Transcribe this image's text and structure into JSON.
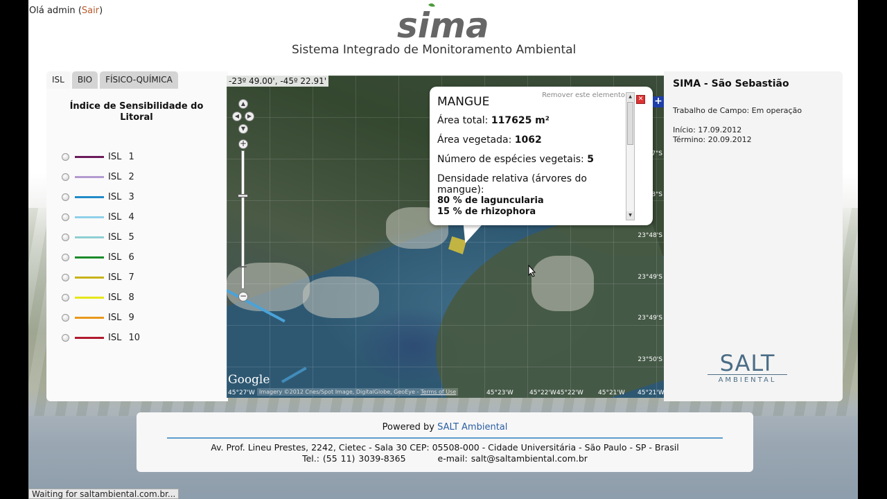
{
  "header": {
    "greeting": "Olá admin",
    "open_paren": "(",
    "logout": "Sair",
    "close_paren": ")",
    "logo": "sima",
    "subtitle": "Sistema Integrado de Monitoramento Ambiental"
  },
  "tabs": [
    {
      "label": "ISL",
      "active": true
    },
    {
      "label": "BIO",
      "active": false
    },
    {
      "label": "FÍSICO-QUÍMICA",
      "active": false
    }
  ],
  "legend": {
    "title": "Índice de Sensibilidade do Litoral",
    "items": [
      {
        "label": "ISL 1",
        "color": "#6b1a5a"
      },
      {
        "label": "ISL 2",
        "color": "#b39ad0"
      },
      {
        "label": "ISL 3",
        "color": "#1f8bc8"
      },
      {
        "label": "ISL 4",
        "color": "#8fd0ea"
      },
      {
        "label": "ISL 5",
        "color": "#8ecfd3"
      },
      {
        "label": "ISL 6",
        "color": "#1a8a2a"
      },
      {
        "label": "ISL 7",
        "color": "#c9b21a"
      },
      {
        "label": "ISL 8",
        "color": "#e6e61a"
      },
      {
        "label": "ISL 9",
        "color": "#e8981c"
      },
      {
        "label": "ISL 10",
        "color": "#b01a2e"
      }
    ]
  },
  "map": {
    "coords": "-23º 49.00', -45º 22.91'",
    "lat_labels": [
      "7\"S",
      "8\"S",
      "23°48'S",
      "23°49'S",
      "23°49'S",
      "23°50'S"
    ],
    "lon_labels": [
      "45°27'W",
      "45°23'W",
      "45°22'W",
      "45°22'W",
      "45°21'W",
      "45°21'W"
    ],
    "google": "Google",
    "imagery": "Imagery ©2012 Cnes/Spot Image, DigitalGlobe, GeoEye -",
    "terms": "Terms of Use",
    "pan_icons": [
      "▲",
      "◀",
      "▶",
      "▼"
    ],
    "zoom_in": "+",
    "zoom_out": "−",
    "plus_button": "+"
  },
  "info": {
    "remove": "Remover este elemento",
    "close": "✕",
    "title": "MANGUE",
    "area_total_label": "Área total:",
    "area_total_value": "117625 m²",
    "area_veg_label": "Área vegetada:",
    "area_veg_value": "1062",
    "species_label": "Número de espécies vegetais:",
    "species_value": "5",
    "density_label": "Densidade relativa (árvores do mangue):",
    "pct1": "80 % de laguncularia",
    "pct2": "15 % de rhizophora",
    "scroll_up": "▲",
    "scroll_down": "▼"
  },
  "right_panel": {
    "title": "SIMA - São Sebastião",
    "status": "Trabalho de Campo: Em operação",
    "start": "Início: 17.09.2012",
    "end": "Término: 20.09.2012",
    "brand": "SALT",
    "brand_sub": "AMBIENTAL"
  },
  "footer": {
    "powered_prefix": "Powered by",
    "powered_link": "SALT Ambiental",
    "address": "Av. Prof. Lineu Prestes, 2242, Cietec - Sala 30 CEP: 05508-000 - Cidade Universitária - São Paulo - SP - Brasil",
    "phone": "Tel.: (55 11) 3039-8365",
    "email": "e-mail: salt@saltambiental.com.br"
  },
  "status_bar": "Waiting for saltambiental.com.br..."
}
